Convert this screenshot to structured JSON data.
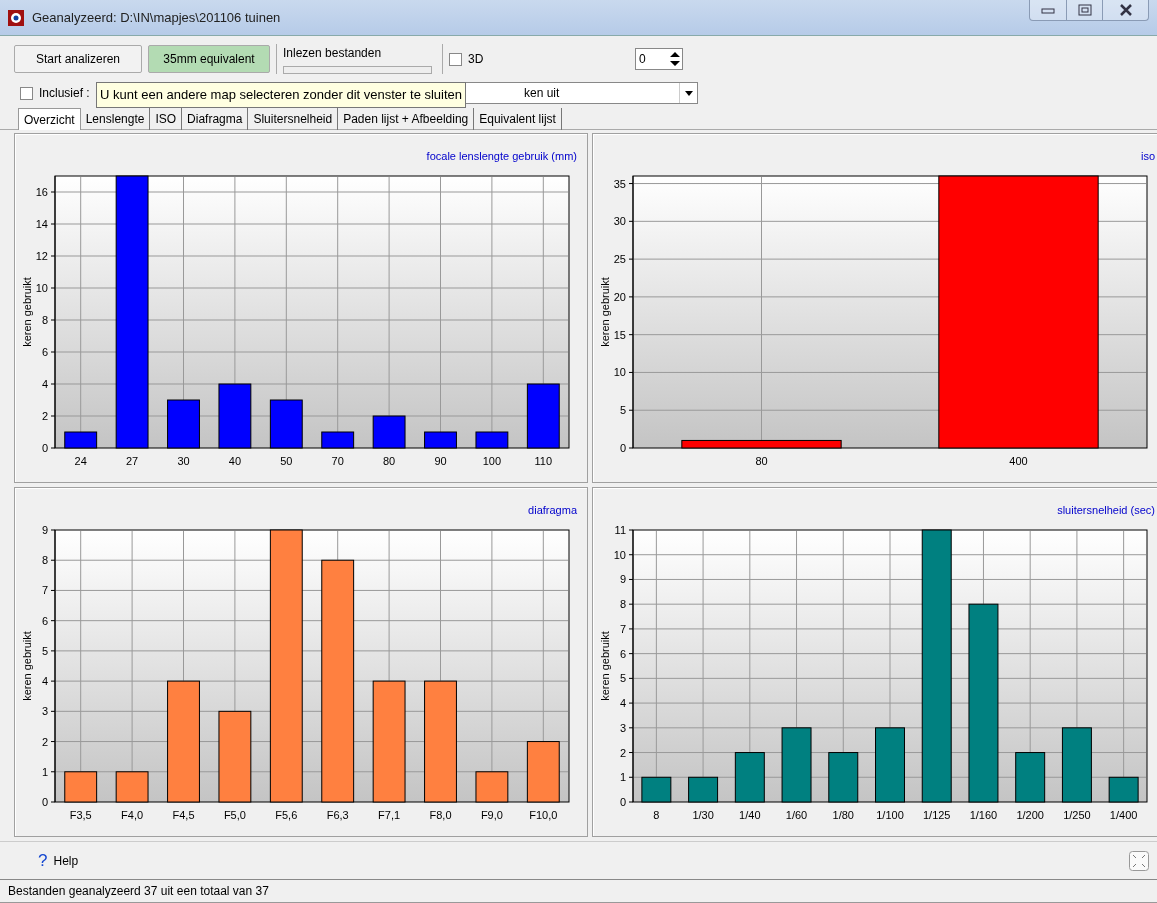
{
  "window": {
    "title": "Geanalyzeerd: D:\\IN\\mapjes\\201106 tuinen"
  },
  "toolbar": {
    "start_button": "Start analizeren",
    "equivalent_button": {
      "label": "35mm equivalent",
      "on": true
    },
    "progress": {
      "label": "Inlezen bestanden"
    },
    "checkbox_3d": {
      "label": "3D",
      "checked": false
    },
    "spin": {
      "value": "0"
    }
  },
  "options": {
    "inclusief": {
      "label": "Inclusief :",
      "checked": false
    },
    "combo": {
      "value": "ken uit"
    },
    "tooltip": "U kunt een andere map selecteren zonder dit venster te sluiten"
  },
  "tabs": [
    {
      "label": "Overzicht",
      "selected": true
    },
    {
      "label": "Lenslengte",
      "selected": false
    },
    {
      "label": "ISO",
      "selected": false
    },
    {
      "label": "Diafragma",
      "selected": false
    },
    {
      "label": "Sluitersnelheid",
      "selected": false
    },
    {
      "label": "Paden lijst + Afbeelding",
      "selected": false
    },
    {
      "label": "Equivalent lijst",
      "selected": false
    }
  ],
  "charts": [
    {
      "chart_data": {
        "type": "bar",
        "title": "focale lenslengte gebruik  (mm)",
        "ylabel": "keren gebruikt",
        "categories": [
          "24",
          "27",
          "30",
          "40",
          "50",
          "70",
          "80",
          "90",
          "100",
          "110"
        ],
        "series": [
          {
            "color": "#0000ff",
            "values": [
              1,
              17,
              3,
              4,
              3,
              1,
              2,
              1,
              1,
              4
            ]
          }
        ],
        "ylim": [
          0,
          17
        ],
        "grid": true,
        "yticks": [
          0,
          2,
          4,
          6,
          8,
          10,
          12,
          14,
          16
        ]
      }
    },
    {
      "chart_data": {
        "type": "bar",
        "title": "iso",
        "ylabel": "keren gebruikt",
        "categories": [
          "80",
          "400"
        ],
        "series": [
          {
            "color": "#ff0000",
            "values": [
              1,
              36
            ]
          }
        ],
        "ylim": [
          0,
          36
        ],
        "grid": true,
        "yticks": [
          0,
          5,
          10,
          15,
          20,
          25,
          30,
          35
        ]
      }
    },
    {
      "chart_data": {
        "type": "bar",
        "title": "diafragma",
        "ylabel": "keren gebruikt",
        "categories": [
          "F3,5",
          "F4,0",
          "F4,5",
          "F5,0",
          "F5,6",
          "F6,3",
          "F7,1",
          "F8,0",
          "F9,0",
          "F10,0"
        ],
        "series": [
          {
            "color": "#ff8040",
            "values": [
              1,
              1,
              4,
              3,
              9,
              8,
              4,
              4,
              1,
              2
            ]
          }
        ],
        "ylim": [
          0,
          9
        ],
        "grid": true,
        "yticks": [
          0,
          1,
          2,
          3,
          4,
          5,
          6,
          7,
          8,
          9
        ]
      }
    },
    {
      "chart_data": {
        "type": "bar",
        "title": "sluitersnelheid (sec)",
        "ylabel": "keren gebruikt",
        "categories": [
          "8",
          "1/30",
          "1/40",
          "1/60",
          "1/80",
          "1/100",
          "1/125",
          "1/160",
          "1/200",
          "1/250",
          "1/400"
        ],
        "series": [
          {
            "color": "#008080",
            "values": [
              1,
              1,
              2,
              3,
              2,
              3,
              11,
              8,
              2,
              3,
              1
            ]
          }
        ],
        "ylim": [
          0,
          11
        ],
        "grid": true,
        "yticks": [
          0,
          1,
          2,
          3,
          4,
          5,
          6,
          7,
          8,
          9,
          10,
          11
        ]
      }
    }
  ],
  "help": {
    "symbol": "?",
    "label": "Help"
  },
  "status_bar": "Bestanden geanalyzeerd 37 uit een totaal van 37"
}
